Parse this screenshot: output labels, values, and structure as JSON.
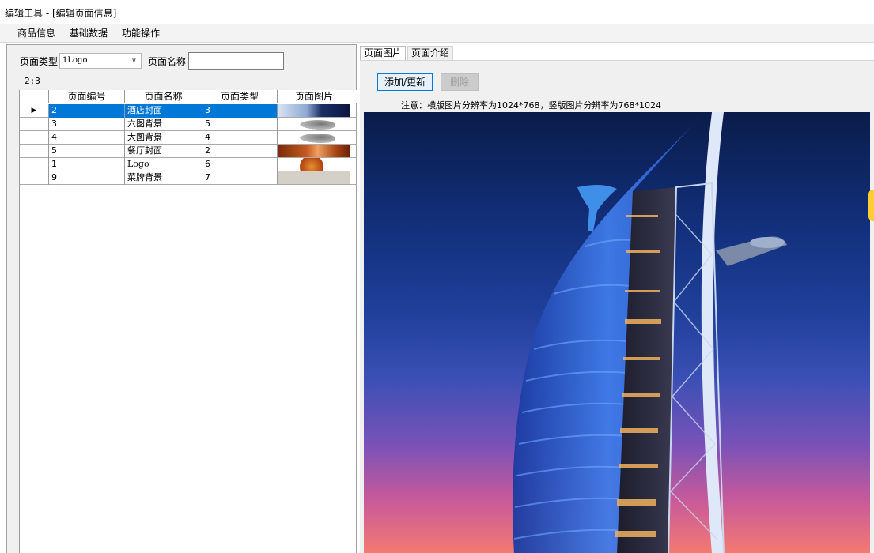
{
  "window": {
    "title": "编辑工具 - [编辑页面信息]"
  },
  "menu": {
    "items": [
      "商品信息",
      "基础数据",
      "功能操作"
    ]
  },
  "filter": {
    "type_label": "页面类型",
    "type_value": "1Logo",
    "name_label": "页面名称",
    "name_value": ""
  },
  "record_count": "2:3",
  "grid": {
    "columns": [
      "页面编号",
      "页面名称",
      "页面类型",
      "页面图片"
    ],
    "rows": [
      {
        "id": "2",
        "name": "酒店封面",
        "type": "3",
        "selected": true
      },
      {
        "id": "3",
        "name": "六图背景",
        "type": "5"
      },
      {
        "id": "4",
        "name": "大图背景",
        "type": "4"
      },
      {
        "id": "5",
        "name": "餐厅封面",
        "type": "2"
      },
      {
        "id": "1",
        "name": "Logo",
        "type": "6"
      },
      {
        "id": "9",
        "name": "菜牌背景",
        "type": "7"
      }
    ]
  },
  "tabs": [
    "页面图片",
    "页面介绍"
  ],
  "actions": {
    "add_label": "添加/更新",
    "delete_label": "删除"
  },
  "notice": "注意：横版图片分辨率为1024*768，竖版图片分辨率为768*1024",
  "colors": {
    "selection": "#0078d7",
    "accent_tab": "#ffcc33"
  }
}
